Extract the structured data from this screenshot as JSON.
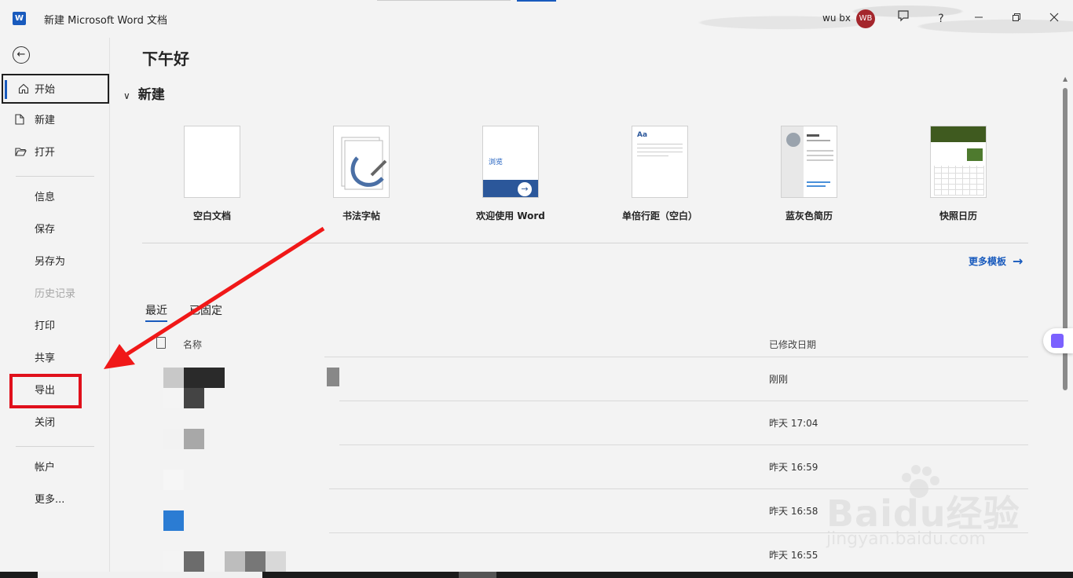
{
  "titlebar": {
    "app_icon": "W",
    "title": "新建 Microsoft Word 文档",
    "user_name": "wu bx",
    "avatar_initials": "WB",
    "help_label": "?",
    "brand_color": "#185abd"
  },
  "sidebar": {
    "items": [
      {
        "label": "开始",
        "icon": "home-icon"
      },
      {
        "label": "新建",
        "icon": "new-doc-icon"
      },
      {
        "label": "打开",
        "icon": "folder-icon"
      },
      {
        "label": "信息"
      },
      {
        "label": "保存"
      },
      {
        "label": "另存为"
      },
      {
        "label": "历史记录"
      },
      {
        "label": "打印"
      },
      {
        "label": "共享"
      },
      {
        "label": "导出"
      },
      {
        "label": "关闭"
      },
      {
        "label": "帐户"
      },
      {
        "label": "更多..."
      }
    ]
  },
  "main": {
    "greeting": "下午好",
    "new_section": "新建",
    "templates": [
      {
        "label": "空白文档"
      },
      {
        "label": "书法字帖"
      },
      {
        "label": "欢迎使用 Word",
        "thumb_text": "浏览"
      },
      {
        "label": "单倍行距（空白）",
        "thumb_text": "Aa"
      },
      {
        "label": "蓝灰色简历"
      },
      {
        "label": "快照日历"
      }
    ],
    "more_templates": "更多模板",
    "tabs": [
      "最近",
      "已固定"
    ],
    "columns": {
      "name": "名称",
      "modified": "已修改日期"
    },
    "recent_dates": [
      "刚刚",
      "昨天 17:04",
      "昨天 16:59",
      "昨天 16:58",
      "昨天 16:55"
    ]
  },
  "watermark": {
    "text": "Baidu经验",
    "sub": "jingyan.baidu.com"
  }
}
